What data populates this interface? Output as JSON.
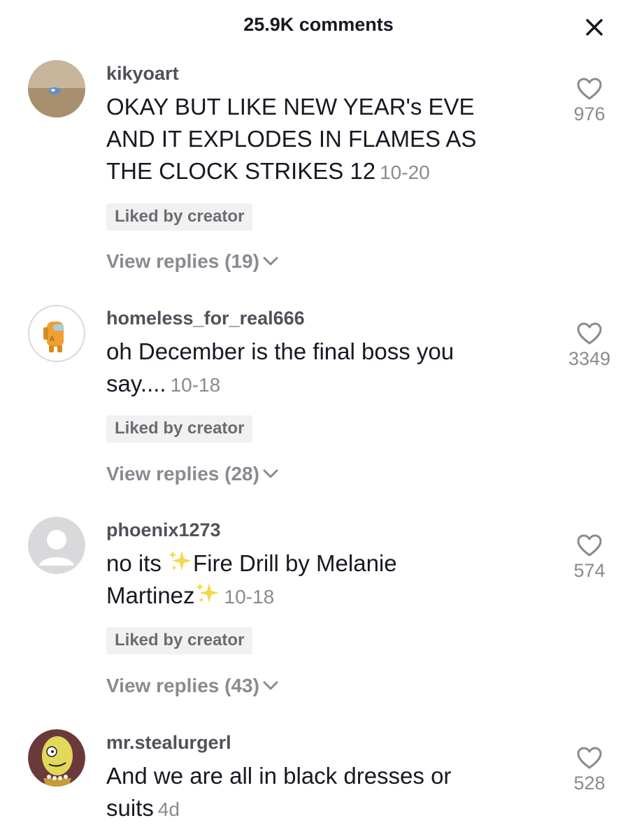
{
  "header": {
    "title": "25.9K comments",
    "close_icon": "close-icon"
  },
  "comments": [
    {
      "username": "kikyoart",
      "lines": [
        "OKAY BUT LIKE NEW YEAR's EVE",
        "AND IT EXPLODES IN FLAMES AS",
        "THE CLOCK STRIKES 12"
      ],
      "date": "10-20",
      "badge": "Liked by creator",
      "replies": "View replies (19)",
      "likes": "976"
    },
    {
      "username": "homeless_for_real666",
      "lines": [
        "oh December is the final boss you",
        "say...."
      ],
      "date": "10-18",
      "badge": "Liked by creator",
      "replies": "View replies (28)",
      "likes": "3349"
    },
    {
      "username": "phoenix1273",
      "line1_a": "no its",
      "line1_b": "Fire Drill by Melanie",
      "line2": "Martinez",
      "date": "10-18",
      "badge": "Liked by creator",
      "replies": "View replies (43)",
      "likes": "574"
    },
    {
      "username": "mr.stealurgerl",
      "lines": [
        "And we are all in black dresses or",
        "suits"
      ],
      "date": "4d",
      "likes": "528"
    }
  ],
  "icons": {
    "heart": "heart-outline-icon",
    "chevron": "chevron-down-icon",
    "sparkle": "sparkles-emoji-icon"
  },
  "colors": {
    "primary_text": "#161823",
    "secondary_text": "#8a8b91",
    "username": "#50525a",
    "badge_bg": "#f1f1f2"
  }
}
